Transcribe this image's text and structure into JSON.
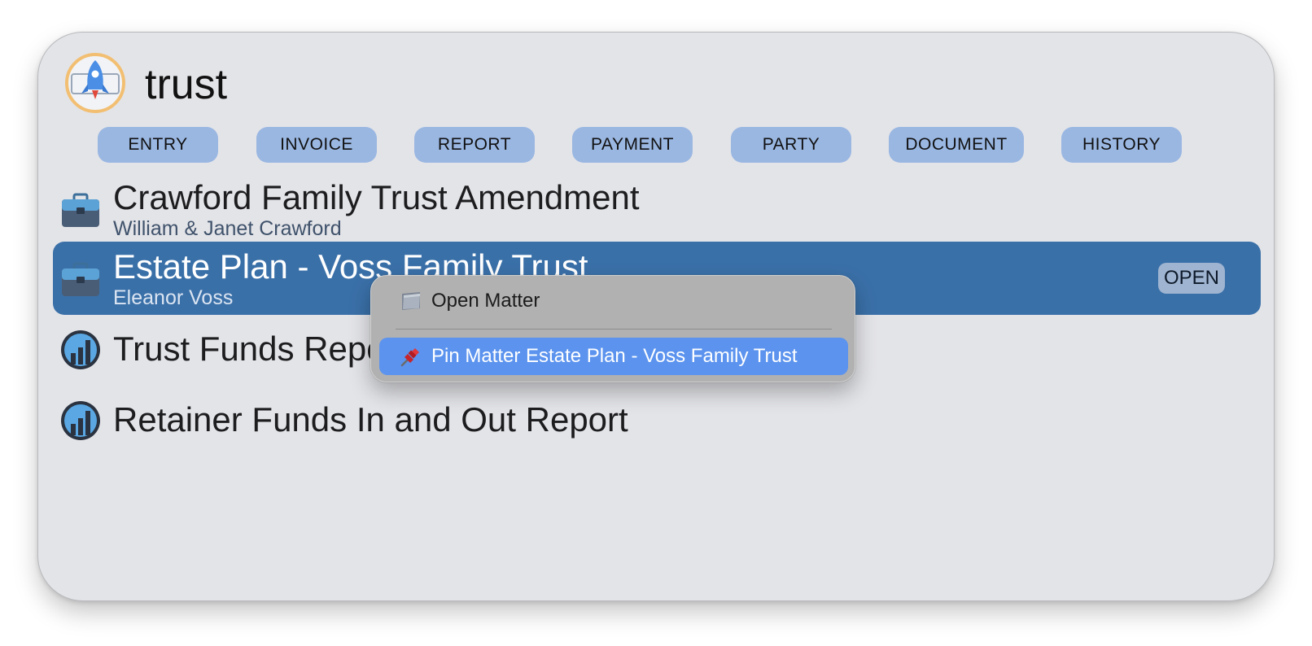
{
  "search": {
    "query": "trust"
  },
  "categories": [
    {
      "label": "ENTRY"
    },
    {
      "label": "INVOICE"
    },
    {
      "label": "REPORT"
    },
    {
      "label": "PAYMENT"
    },
    {
      "label": "PARTY"
    },
    {
      "label": "DOCUMENT"
    },
    {
      "label": "HISTORY"
    }
  ],
  "results": [
    {
      "icon": "briefcase-icon",
      "title": "Crawford Family Trust Amendment",
      "subtitle": "William & Janet Crawford"
    },
    {
      "icon": "briefcase-icon",
      "title": "Estate Plan - Voss Family Trust",
      "subtitle": "Eleanor Voss",
      "selected": true,
      "badge": "OPEN"
    },
    {
      "icon": "report-chart-icon",
      "title": "Trust Funds Report"
    },
    {
      "icon": "report-chart-icon",
      "title": "Retainer Funds In and Out Report"
    }
  ],
  "context_menu": {
    "items": [
      {
        "icon": "folder-icon",
        "label": "Open Matter"
      },
      {
        "icon": "pushpin-icon",
        "label": "Pin Matter Estate Plan - Voss Family Trust",
        "highlighted": true
      }
    ]
  },
  "colors": {
    "window_bg": "#e3e4e8",
    "chip_bg": "#9ab7e2",
    "selection": "#3a70a8",
    "menu_bg": "#b1b1b1",
    "menu_highlight": "#5b93ee"
  }
}
